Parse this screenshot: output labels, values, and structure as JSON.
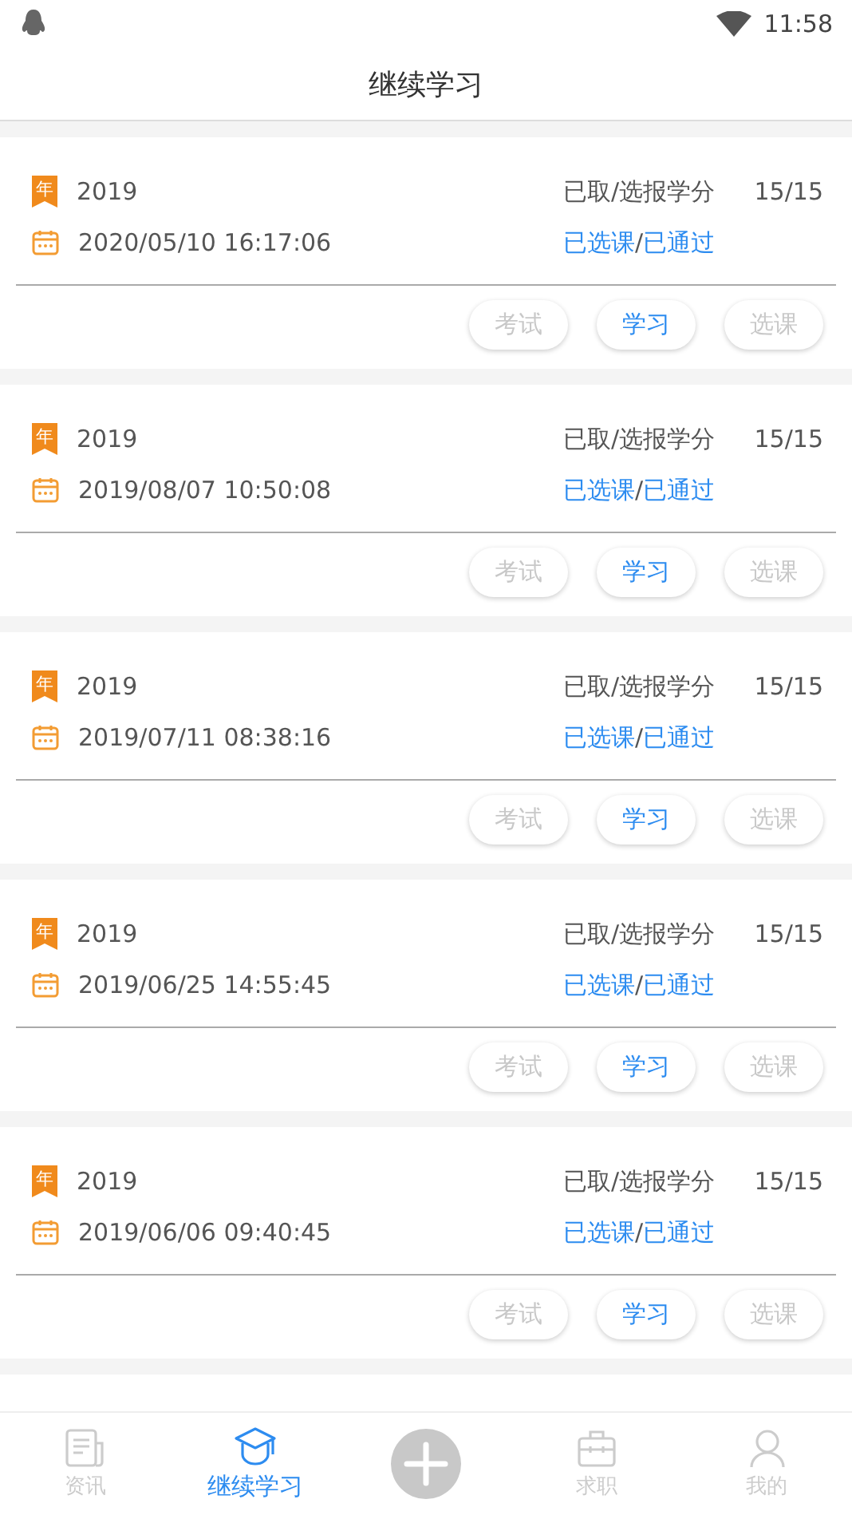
{
  "status_bar": {
    "time": "11:58"
  },
  "title": "继续学习",
  "records": [
    {
      "year_badge": "年",
      "year": "2019",
      "datetime": "2020/05/10 16:17:06",
      "credit_label": "已取/选报学分",
      "credits": "15/15",
      "status_parts": [
        "已选课",
        "/",
        "已通过"
      ],
      "buttons": [
        {
          "label": "考试",
          "disabled": true
        },
        {
          "label": "学习",
          "disabled": false
        },
        {
          "label": "选课",
          "disabled": true
        }
      ]
    },
    {
      "year_badge": "年",
      "year": "2019",
      "datetime": "2019/08/07 10:50:08",
      "credit_label": "已取/选报学分",
      "credits": "15/15",
      "status_parts": [
        "已选课",
        "/",
        "已通过"
      ],
      "buttons": [
        {
          "label": "考试",
          "disabled": true
        },
        {
          "label": "学习",
          "disabled": false
        },
        {
          "label": "选课",
          "disabled": true
        }
      ]
    },
    {
      "year_badge": "年",
      "year": "2019",
      "datetime": "2019/07/11 08:38:16",
      "credit_label": "已取/选报学分",
      "credits": "15/15",
      "status_parts": [
        "已选课",
        "/",
        "已通过"
      ],
      "buttons": [
        {
          "label": "考试",
          "disabled": true
        },
        {
          "label": "学习",
          "disabled": false
        },
        {
          "label": "选课",
          "disabled": true
        }
      ]
    },
    {
      "year_badge": "年",
      "year": "2019",
      "datetime": "2019/06/25 14:55:45",
      "credit_label": "已取/选报学分",
      "credits": "15/15",
      "status_parts": [
        "已选课",
        "/",
        "已通过"
      ],
      "buttons": [
        {
          "label": "考试",
          "disabled": true
        },
        {
          "label": "学习",
          "disabled": false
        },
        {
          "label": "选课",
          "disabled": true
        }
      ]
    },
    {
      "year_badge": "年",
      "year": "2019",
      "datetime": "2019/06/06 09:40:45",
      "credit_label": "已取/选报学分",
      "credits": "15/15",
      "status_parts": [
        "已选课",
        "/",
        "已通过"
      ],
      "buttons": [
        {
          "label": "考试",
          "disabled": true
        },
        {
          "label": "学习",
          "disabled": false
        },
        {
          "label": "选课",
          "disabled": true
        }
      ]
    }
  ],
  "nav": [
    {
      "kind": "news",
      "label": "资讯",
      "selected": false
    },
    {
      "kind": "study",
      "label": "继续学习",
      "selected": true
    },
    {
      "kind": "add"
    },
    {
      "kind": "jobs",
      "label": "求职",
      "selected": false
    },
    {
      "kind": "me",
      "label": "我的",
      "selected": false
    }
  ]
}
